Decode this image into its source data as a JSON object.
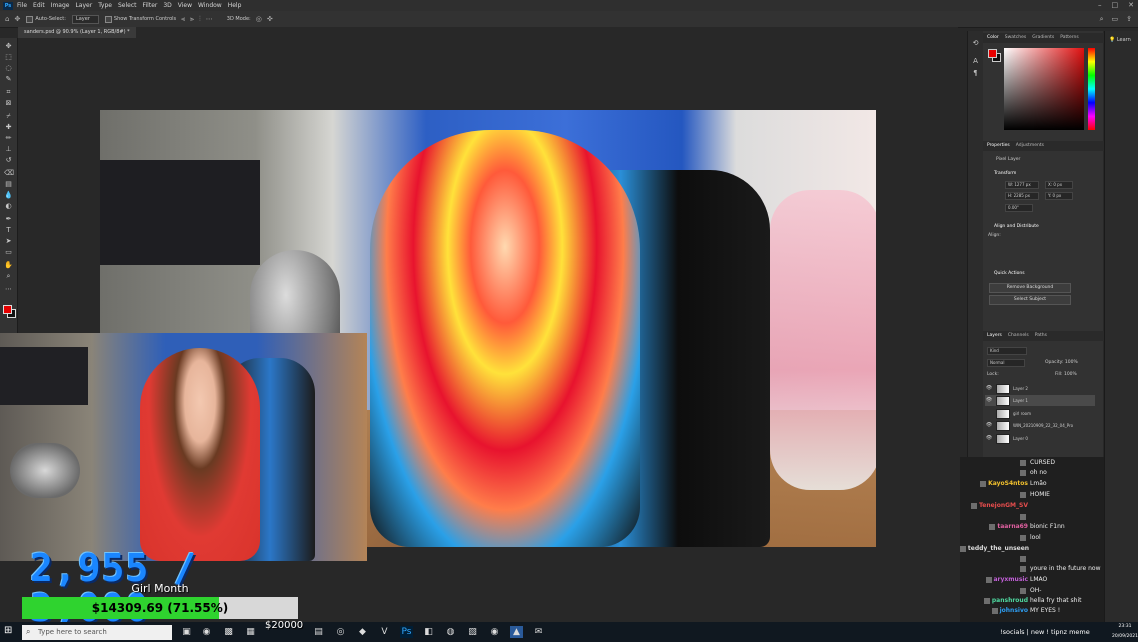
{
  "menu": {
    "app_icon": "Ps",
    "items": [
      "File",
      "Edit",
      "Image",
      "Layer",
      "Type",
      "Select",
      "Filter",
      "3D",
      "View",
      "Window",
      "Help"
    ]
  },
  "options": {
    "auto_select": "Auto-Select:",
    "target": "Layer",
    "show_transform": "Show Transform Controls",
    "mode_3d": "3D Mode:"
  },
  "document": {
    "tab": "sanders.psd @ 90.9% (Layer 1, RGB/8#) *"
  },
  "panels": {
    "color_tabs": [
      "Color",
      "Swatches",
      "Gradients",
      "Patterns"
    ],
    "properties_tabs": [
      "Properties",
      "Adjustments"
    ],
    "pixel_layer": "Pixel Layer",
    "transform": "Transform",
    "w": "W: 1277 px",
    "h": "H: 2285 px",
    "x": "X: 0 px",
    "y": "Y: 0 px",
    "angle": "0.00°",
    "align": "Align and Distribute",
    "align_sub": "Align:",
    "quick_actions": "Quick Actions",
    "remove_bg": "Remove Background",
    "select_subject": "Select Subject",
    "layers_tabs": [
      "Layers",
      "Channels",
      "Paths"
    ],
    "kind": "Kind",
    "blend": "Normal",
    "opacity": "Opacity: 100%",
    "lock": "Lock:",
    "fill": "Fill: 100%",
    "layers": [
      {
        "name": "Layer 2",
        "selected": false
      },
      {
        "name": "Layer 1",
        "selected": true
      },
      {
        "name": "girl room",
        "selected": false
      },
      {
        "name": "WIN_20210909_22_32_04_Pro",
        "selected": false
      },
      {
        "name": "Layer 0",
        "selected": false
      }
    ],
    "far_right": "Learn"
  },
  "overlay": {
    "counter": "2,955 / 3,000",
    "goal_name": "Girl Month",
    "goal_text": "$14309.69 (71.55%)",
    "goal_percent": 71.55,
    "amount": "$20000"
  },
  "chat": [
    {
      "user": "",
      "color": "#9a5fd6",
      "text": "CURSED"
    },
    {
      "user": "",
      "color": "#7a5fd6",
      "text": "oh no"
    },
    {
      "user": "KayoS4ntos",
      "color": "#f2c12e",
      "text": "Lmão"
    },
    {
      "user": "",
      "color": "#b45fd6",
      "text": "HOMIE"
    },
    {
      "user": "TenejonGM_SV",
      "color": "#e84d4d",
      "text": ""
    },
    {
      "user": "",
      "color": "#c04fd8",
      "text": ""
    },
    {
      "user": "taarna69",
      "color": "#e060a0",
      "text": "bionic F1nn"
    },
    {
      "user": "",
      "color": "#6b4fd8",
      "text": "lool"
    },
    {
      "user": "teddy_the_unseen",
      "color": "#dddddd",
      "text": ""
    },
    {
      "user": "",
      "color": "#8a5fd6",
      "text": ""
    },
    {
      "user": "",
      "color": "#d04040",
      "text": "youre in the future now"
    },
    {
      "user": "aryxmusic",
      "color": "#c05fd6",
      "text": "LMAO"
    },
    {
      "user": "",
      "color": "#5f7fd6",
      "text": "OH-"
    },
    {
      "user": "panshroud",
      "color": "#4fd8a0",
      "text": "hella fry that shit"
    },
    {
      "user": "johnsivo",
      "color": "#2e9ef2",
      "text": "MY EYES !"
    }
  ],
  "taskbar": {
    "search_placeholder": "Type here to search",
    "ticker": "!socials | new ! tipnz meme",
    "time": "23:31",
    "date": "20/09/2021"
  },
  "colors": {
    "foreground": "#e60000",
    "background": "#111111",
    "progress_fill": "#2fd32f",
    "counter": "#1a86ff"
  }
}
